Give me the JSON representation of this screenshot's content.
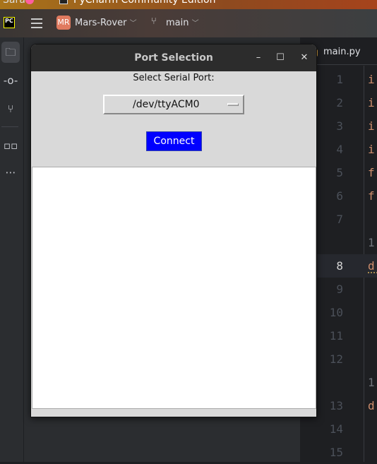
{
  "system_bar": {
    "user": "Sara",
    "app_title": "PyCharm Community Edition"
  },
  "ide_header": {
    "logo": "PC",
    "project_badge": "MR",
    "project_name": "Mars-Rover",
    "branch": "main"
  },
  "editor": {
    "tab": "main.py",
    "rows": [
      {
        "ln": "1",
        "code": "i"
      },
      {
        "ln": "2",
        "code": "i"
      },
      {
        "ln": "3",
        "code": "i"
      },
      {
        "ln": "4",
        "code": "i"
      },
      {
        "ln": "5",
        "code": "f"
      },
      {
        "ln": "6",
        "code": "f"
      },
      {
        "ln": "7",
        "code": ""
      },
      {
        "ln": "",
        "code": "1"
      },
      {
        "ln": "8",
        "code": "d"
      },
      {
        "ln": "9",
        "code": ""
      },
      {
        "ln": "10",
        "code": ""
      },
      {
        "ln": "11",
        "code": ""
      },
      {
        "ln": "12",
        "code": ""
      },
      {
        "ln": "",
        "code": "1"
      },
      {
        "ln": "13",
        "code": "d"
      },
      {
        "ln": "14",
        "code": ""
      },
      {
        "ln": "15",
        "code": ""
      }
    ]
  },
  "dialog": {
    "title": "Port Selection",
    "minimize": "–",
    "maximize": "☐",
    "close": "✕",
    "label": "Select Serial Port:",
    "selected_port": "/dev/ttyACM0",
    "connect_label": "Connect",
    "connect_color": "#0000ff",
    "output_text": ""
  }
}
